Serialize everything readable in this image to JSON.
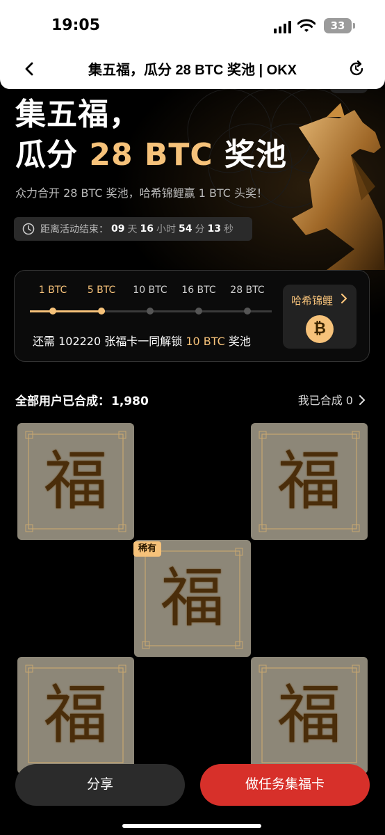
{
  "status_bar": {
    "time": "19:05",
    "battery": "33"
  },
  "nav": {
    "title": "集五福，瓜分 28 BTC 奖池 | OKX"
  },
  "hero": {
    "headline_line1": "集五福，",
    "headline_prefix": "瓜分 ",
    "headline_accent": "28 BTC",
    "headline_suffix": " 奖池",
    "subline": "众力合开 28 BTC 奖池，哈希锦鲤赢 1 BTC 头奖！",
    "countdown": {
      "label": "距离活动结束：",
      "days": "09",
      "days_unit": "天",
      "hours": "16",
      "hours_unit": "小时",
      "minutes": "54",
      "minutes_unit": "分",
      "seconds": "13",
      "seconds_unit": "秒"
    }
  },
  "progress": {
    "tiers": [
      {
        "label": "1 BTC",
        "reached": true
      },
      {
        "label": "5 BTC",
        "reached": true
      },
      {
        "label": "10 BTC",
        "reached": false
      },
      {
        "label": "16 BTC",
        "reached": false
      },
      {
        "label": "28 BTC",
        "reached": false
      }
    ],
    "unlock_prefix": "还需 102220 张福卡一同解锁 ",
    "unlock_accent": "10 BTC",
    "unlock_suffix": " 奖池",
    "koi": {
      "label": "哈希锦鲤",
      "coin_symbol": "₿"
    }
  },
  "stats": {
    "all_users_label": "全部用户已合成：",
    "all_users_value": "1,980",
    "mine_label": "我已合成 0"
  },
  "cards": [
    {
      "char": "福"
    },
    {
      "char": "福"
    },
    {
      "char": "福",
      "badge": "稀有"
    },
    {
      "char": "福"
    },
    {
      "char": "福"
    }
  ],
  "actions": {
    "share": "分享",
    "task": "做任务集福卡"
  },
  "colors": {
    "accent_gold": "#f6c27a",
    "primary_red": "#d7302a",
    "card_bg": "#8d8778"
  }
}
